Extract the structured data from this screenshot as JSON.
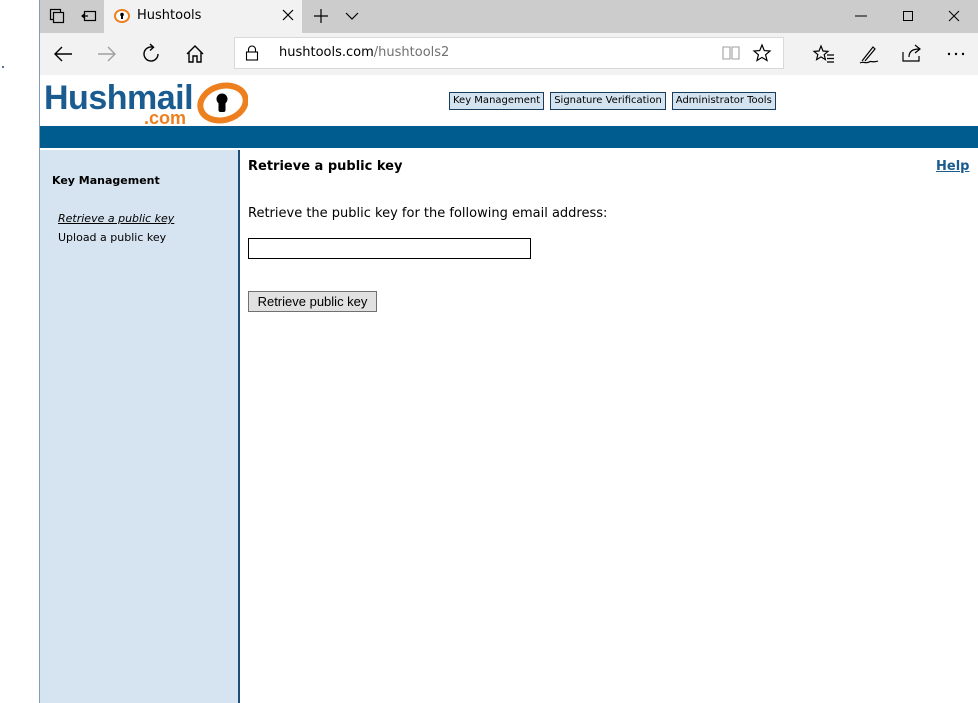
{
  "browser": {
    "tab_title": "Hushtools",
    "url_host": "hushtools.com",
    "url_path": "/hushtools2"
  },
  "logo": {
    "name": "Hushmail",
    "domain": ".com"
  },
  "top_nav": [
    {
      "label": "Key Management"
    },
    {
      "label": "Signature Verification"
    },
    {
      "label": "Administrator Tools"
    }
  ],
  "sidebar": {
    "title": "Key Management",
    "items": [
      {
        "label": "Retrieve a public key",
        "active": true
      },
      {
        "label": "Upload a public key",
        "active": false
      }
    ]
  },
  "content": {
    "title": "Retrieve a public key",
    "help_label": "Help",
    "description": "Retrieve the public key for the following email address:",
    "email_value": "",
    "button_label": "Retrieve public key"
  },
  "colors": {
    "brand_blue": "#1a5c8f",
    "brand_orange": "#ee7f1e",
    "header_bar": "#005b8f",
    "sidebar_bg": "#d6e3f0"
  }
}
